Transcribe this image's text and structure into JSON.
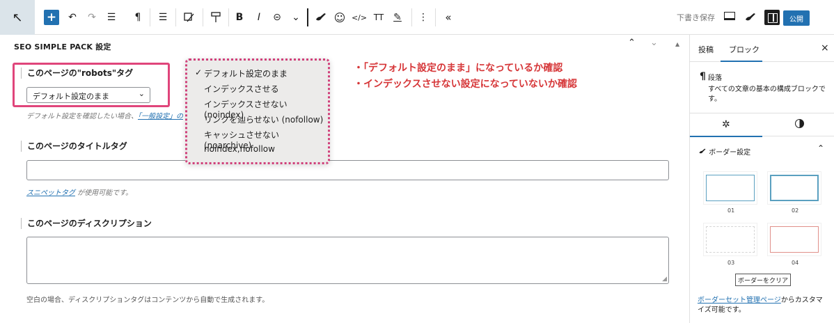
{
  "toolbar": {
    "save_draft": "下書き保存",
    "publish": "公開",
    "icons": [
      "select-arrow-icon",
      "add-block-icon",
      "undo-icon",
      "redo-icon",
      "list-view-icon",
      "paragraph-icon",
      "align-icon",
      "highlight-icon",
      "format-icon",
      "bold-icon",
      "italic-icon",
      "link-icon",
      "more-chevron-icon",
      "brush-icon",
      "emoji-icon",
      "code-icon",
      "text-size-icon",
      "pen-icon",
      "more-options-icon",
      "collapse-icon"
    ],
    "glyphs": {
      "arrow": "↖",
      "plus": "+",
      "undo": "↶",
      "redo": "↷",
      "list": "☰",
      "pilcrow": "¶",
      "align": "☰",
      "bold": "B",
      "italic": "I",
      "link": "⊝",
      "chevron": "⌄",
      "emoji": "☺",
      "code": "</>",
      "textsize": "TT",
      "pen": "✎",
      "dots": "⋮",
      "collapse": "«"
    }
  },
  "main": {
    "panel_title": "SEO SIMPLE PACK 設定",
    "panel_controls": {
      "up": "⌃",
      "down": "⌄",
      "scroll": "▲"
    },
    "robots": {
      "label": "このページの\"robots\"タグ",
      "selected": "デフォルト設定のまま",
      "help_prefix": "デフォルト設定を確認したい場合、",
      "help_link": "「一般設定」の",
      "chevron": "⌄"
    },
    "title_tag": {
      "label": "このページのタイトルタグ",
      "help_link": "スニペットタグ",
      "help_suffix": " が使用可能です。",
      "value": ""
    },
    "description": {
      "label": "このページのディスクリプション",
      "value": "",
      "note": "空白の場合、ディスクリプションタグはコンテンツから自動で生成されます。"
    },
    "dropdown": {
      "check": "✓",
      "options": [
        "デフォルト設定のまま",
        "インデックスさせる",
        "インデックスさせない (noindex)",
        "リンクを辿らせない (nofollow)",
        "キャッシュさせない (noarchive)",
        "noindex,nofollow"
      ]
    },
    "callouts": [
      "・「デフォルト設定のまま」になっているか確認",
      "・インデックスさせない設定になっていないか確認"
    ]
  },
  "sidebar": {
    "tabs": [
      "投稿",
      "ブロック"
    ],
    "close": "×",
    "block": {
      "icon": "¶",
      "name": "段落",
      "description": "すべての文章の基本の構成ブロックです。"
    },
    "subtab_icons": [
      "gear-icon",
      "contrast-icon"
    ],
    "gear_glyph": "✲",
    "border_settings": {
      "title": "ボーダー設定",
      "chevron": "⌃",
      "swatches": [
        {
          "label": "01",
          "color": "#5aa0c0",
          "style": "solid-thin"
        },
        {
          "label": "02",
          "color": "#5aa0c0",
          "style": "solid-thick"
        },
        {
          "label": "03",
          "color": "#d5d5d5",
          "style": "dashed"
        },
        {
          "label": "04",
          "color": "#e0908a",
          "style": "solid-thin"
        }
      ],
      "clear_button": "ボーダーをクリア",
      "manage_link": "ボーダーセット管理ページ",
      "manage_suffix": "からカスタマイズ可能です。"
    }
  },
  "colors": {
    "accent": "#2271b1",
    "highlight": "#e0457b",
    "callout": "#d63638"
  }
}
